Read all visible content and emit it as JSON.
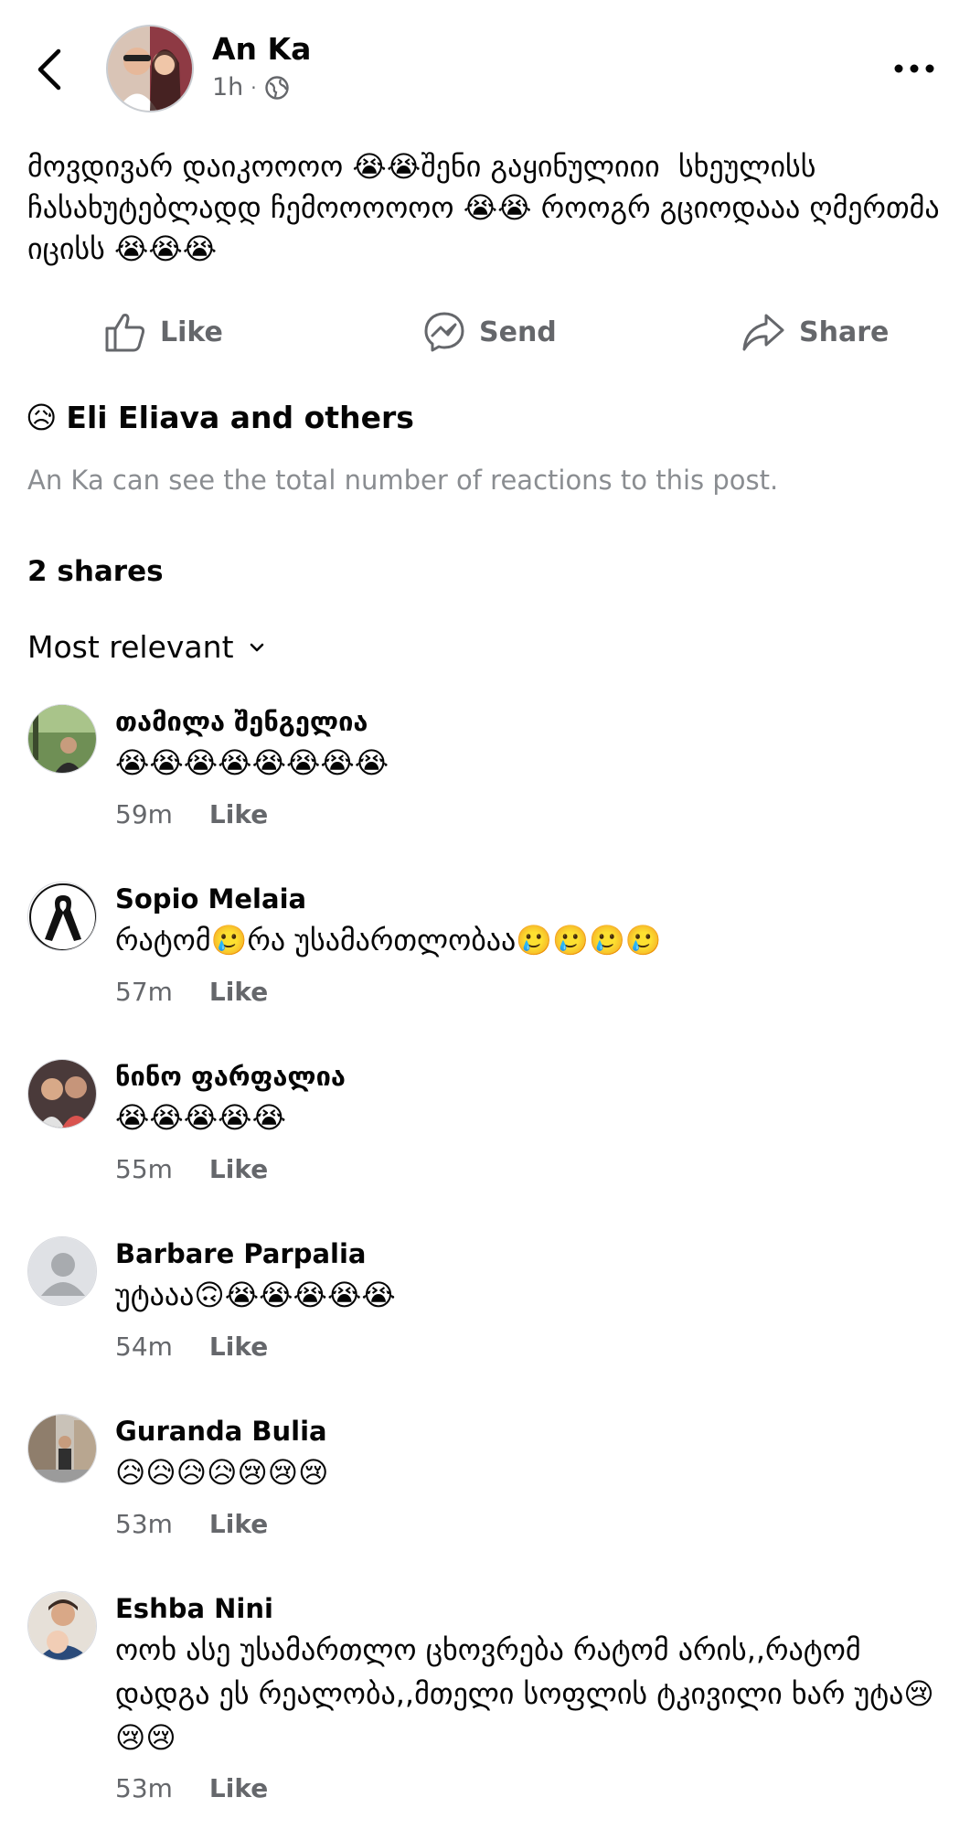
{
  "post": {
    "author": "An Ka",
    "time": "1h",
    "text": "მოვდივარ დაიკოოოო 😭😭შენი გაყინულიიი  სხეულისს ჩასახუტებლადდ ჩემოოოოოო 😭😭 როოგრ გციოდააა ღმერთმა იცისს 😭😭😭"
  },
  "actions": {
    "like": "Like",
    "send": "Send",
    "share": "Share"
  },
  "reactions": {
    "emoji": "😥",
    "summary": "Eli Eliava and others",
    "note": "An Ka can see the total number of reactions to this post."
  },
  "shares": "2 shares",
  "sort": {
    "label": "Most relevant"
  },
  "comments": [
    {
      "name": "თამილა შენგელია",
      "text": "😭😭😭😭😭😭😭😭",
      "time": "59m",
      "like": "Like"
    },
    {
      "name": "Sopio Melaia",
      "text": "რატომ🥲რა უსამართლობაა🥲🥲🥲🥲",
      "time": "57m",
      "like": "Like"
    },
    {
      "name": "ნინო ფარფალია",
      "text": "😭😭😭😭😭",
      "time": "55m",
      "like": "Like"
    },
    {
      "name": "Barbare Parpalia",
      "text": "უტააა🙃😭😭😭😭😭",
      "time": "54m",
      "like": "Like"
    },
    {
      "name": "Guranda Bulia",
      "text": "😥😥😥😥😢😢😢",
      "time": "53m",
      "like": "Like"
    },
    {
      "name": "Eshba Nini",
      "text": "ოოხ ასე უსამართლო ცხოვრება რატომ არის,,რატომ დადგა ეს რეალობა,,მთელი სოფლის ტკივილი ხარ უტა😢😢😢",
      "time": "53m",
      "like": "Like"
    }
  ],
  "colors": {
    "text": "#050505",
    "secondary": "#65676b",
    "muted": "#8a8d91"
  },
  "icons": [
    "back-arrow-icon",
    "globe-icon",
    "more-icon",
    "thumbs-up-icon",
    "messenger-icon",
    "share-arrow-icon",
    "chevron-down-icon",
    "crying-face-icon"
  ]
}
